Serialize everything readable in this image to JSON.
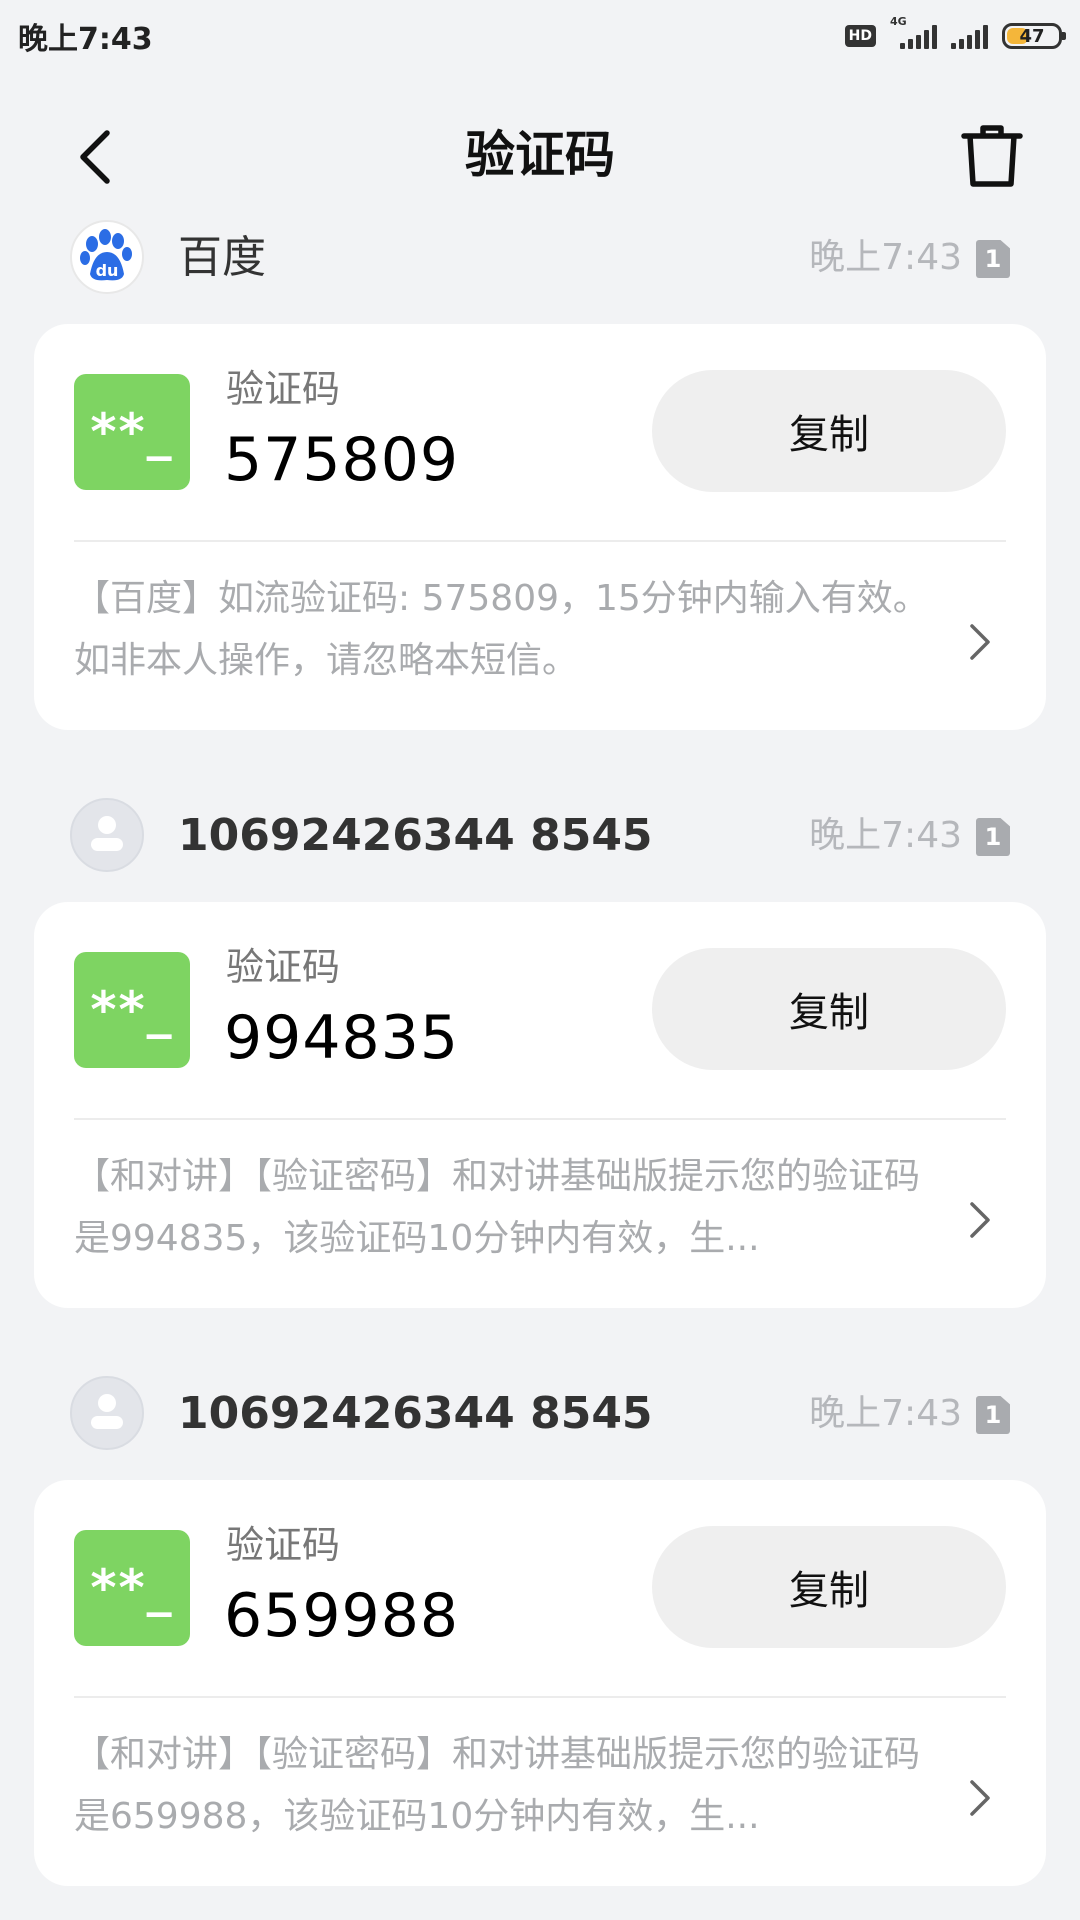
{
  "status_bar": {
    "time": "晚上7:43",
    "hd": "HD",
    "network": "4G",
    "battery_level": "47",
    "battery_fraction": 0.47
  },
  "header": {
    "title": "验证码"
  },
  "icons": {
    "back": "chevron-left-icon",
    "trash": "trash-icon",
    "code": "code-icon",
    "chevron": "chevron-right-icon"
  },
  "colors": {
    "code_icon_bg": "#7ed462",
    "baidu_blue": "#2b6de5",
    "background": "#f2f3f5"
  },
  "messages": [
    {
      "sender": "百度",
      "time": "晚上7:43",
      "sim": "1",
      "code_glyph": "**_",
      "code_label": "验证码",
      "code": "575809",
      "copy_label": "复制",
      "body": "【百度】如流验证码: 575809，15分钟内输入有效。如非本人操作，请忽略本短信。"
    },
    {
      "sender": "10692426344 8545",
      "time": "晚上7:43",
      "sim": "1",
      "code_glyph": "**_",
      "code_label": "验证码",
      "code": "994835",
      "copy_label": "复制",
      "body": "【和对讲】【验证密码】和对讲基础版提示您的验证码是994835，该验证码10分钟内有效，生..."
    },
    {
      "sender": "10692426344 8545",
      "time": "晚上7:43",
      "sim": "1",
      "code_glyph": "**_",
      "code_label": "验证码",
      "code": "659988",
      "copy_label": "复制",
      "body": "【和对讲】【验证密码】和对讲基础版提示您的验证码是659988，该验证码10分钟内有效，生..."
    }
  ]
}
